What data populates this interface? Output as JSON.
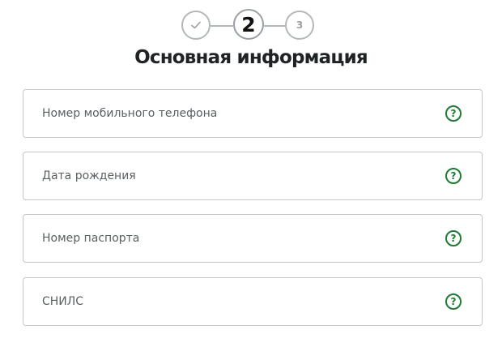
{
  "stepper": {
    "steps": [
      {
        "state": "completed",
        "icon": "check-icon",
        "label": ""
      },
      {
        "state": "current",
        "label": "2"
      },
      {
        "state": "upcoming",
        "label": "3"
      }
    ]
  },
  "title": "Основная информация",
  "form": {
    "fields": [
      {
        "label": "Номер мобильного телефона",
        "help_icon": "question-circle-icon"
      },
      {
        "label": "Дата рождения",
        "help_icon": "question-circle-icon"
      },
      {
        "label": "Номер паспорта",
        "help_icon": "question-circle-icon"
      },
      {
        "label": "СНИЛС",
        "help_icon": "question-circle-icon"
      }
    ]
  },
  "colors": {
    "accent_green": "#1e7a34",
    "step_border": "#b3b8bc",
    "title_text": "#1f2326",
    "field_label": "#5a5f63",
    "field_border": "#c2c6ca"
  }
}
